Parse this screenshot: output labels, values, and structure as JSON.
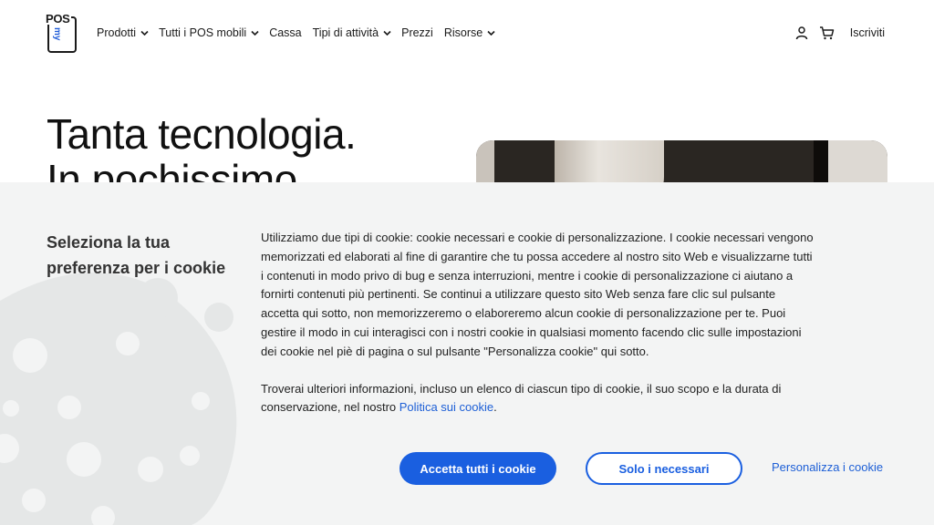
{
  "brand": {
    "logo_text": "POS",
    "logo_sub": "my",
    "accent_color": "#1a5fe0"
  },
  "nav": {
    "items": [
      {
        "label": "Prodotti",
        "has_dropdown": true
      },
      {
        "label": "Tutti i POS mobili",
        "has_dropdown": true
      },
      {
        "label": "Cassa",
        "has_dropdown": false
      },
      {
        "label": "Tipi di attività",
        "has_dropdown": true
      },
      {
        "label": "Prezzi",
        "has_dropdown": false
      },
      {
        "label": "Risorse",
        "has_dropdown": true
      }
    ],
    "account_icon": "user-icon",
    "cart_icon": "cart-icon",
    "signup_label": "Iscriviti"
  },
  "hero": {
    "title_line1": "Tanta tecnologia.",
    "title_line2": "In pochissimo"
  },
  "cookie": {
    "title": "Seleziona la tua preferenza per i cookie",
    "paragraph1": "Utilizziamo due tipi di cookie: cookie necessari e cookie di personalizzazione. I cookie necessari vengono memorizzati ed elaborati al fine di garantire che tu possa accedere al nostro sito Web e visualizzarne tutti i contenuti in modo privo di bug e senza interruzioni, mentre i cookie di personalizzazione ci aiutano a fornirti contenuti più pertinenti. Se continui a utilizzare questo sito Web senza fare clic sul pulsante accetta qui sotto, non memorizzeremo o elaboreremo alcun cookie di personalizzazione per te. Puoi gestire il modo in cui interagisci con i nostri cookie in qualsiasi momento facendo clic sulle impostazioni dei cookie nel piè di pagina o sul pulsante \"Personalizza cookie\" qui sotto.",
    "paragraph2_prefix": "Troverai ulteriori informazioni, incluso un elenco di ciascun tipo di cookie, il suo scopo e la durata di conservazione, nel nostro ",
    "policy_link": "Politica sui cookie",
    "paragraph2_suffix": ".",
    "accept_all_label": "Accetta tutti i cookie",
    "necessary_only_label": "Solo i necessari",
    "customize_label": "Personalizza i cookie"
  }
}
